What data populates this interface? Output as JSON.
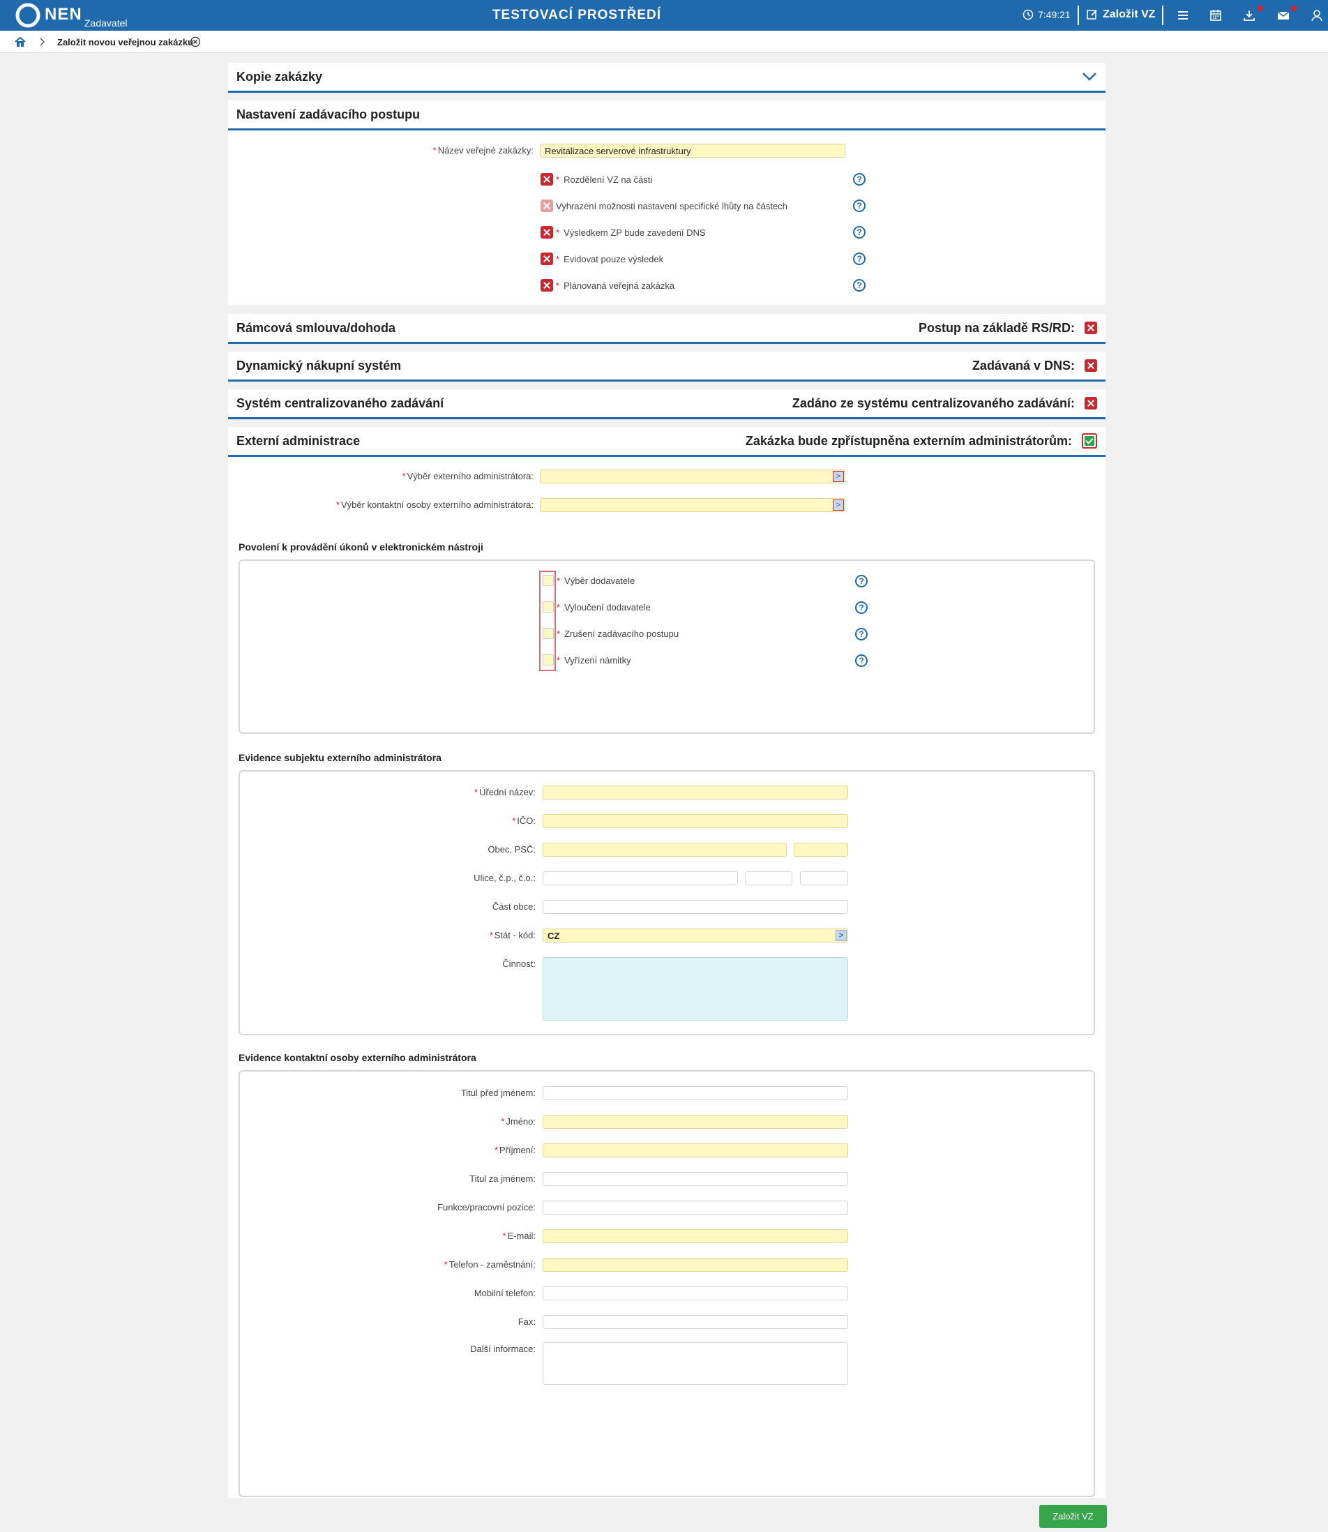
{
  "topbar": {
    "logo": "NEN",
    "logo_sub": "Zadavatel",
    "environment": "TESTOVACÍ PROSTŘEDÍ",
    "clock": "7:49:21",
    "new_button": "Založit VZ",
    "icons": [
      "clock-icon",
      "edit-icon",
      "menu-icon",
      "calendar-icon",
      "download-icon",
      "mail-icon",
      "user-icon"
    ],
    "accent": "#1e6aad"
  },
  "breadcrumb": {
    "current": "Založit novou veřejnou zakázku"
  },
  "kopie": {
    "title": "Kopie zakázky"
  },
  "nastaveni": {
    "title": "Nastavení zadávacího postupu",
    "nazev_label": "Název veřejné zakázky:",
    "nazev_value": "Revitalizace serverové infrastruktury",
    "options": [
      {
        "label": "Rozdělení VZ na části",
        "required": true
      },
      {
        "label": "Vyhrazení možnosti nastavení specifické lhůty na částech",
        "required": false
      },
      {
        "label": "Výsledkem ZP bude zavedení DNS",
        "required": true
      },
      {
        "label": "Evidovat pouze výsledek",
        "required": true
      },
      {
        "label": "Plánovaná veřejná zakázka",
        "required": true
      }
    ]
  },
  "ramcova": {
    "title": "Rámcová smlouva/dohoda",
    "right": "Postup na základě RS/RD:"
  },
  "dns": {
    "title": "Dynamický nákupní systém",
    "right": "Zadávaná v DNS:"
  },
  "centralni": {
    "title": "Systém centralizovaného zadávání",
    "right": "Zadáno ze systému centralizovaného zadávání:"
  },
  "externi": {
    "title": "Externí administrace",
    "right": "Zakázka bude zpřístupněna externím administrátorům:",
    "vyber_admin": "Výběr externího administrátora:",
    "vyber_osoba": "Výběr kontaktní osoby externího administrátora:"
  },
  "povoleni": {
    "title": "Povolení k provádění úkonů v elektronickém nástroji",
    "items": [
      "Výběr dodavatele",
      "Vyloučení dodavatele",
      "Zrušení zadávacího postupu",
      "Vyřízení námitky"
    ]
  },
  "subjekt": {
    "title": "Evidence subjektu externího administrátora",
    "uredni_nazev": "Úřední název:",
    "ico": "IČO:",
    "obec": "Obec, PSČ:",
    "ulice": "Ulice, č.p., č.o.:",
    "cast_obce": "Část obce:",
    "stat": "Stát - kód:",
    "stat_value": "CZ",
    "cinnost": "Činnost:"
  },
  "kontakt": {
    "title": "Evidence kontaktní osoby externího administrátora",
    "fields": [
      {
        "label": "Titul před jménem:",
        "required": false,
        "yellow": false
      },
      {
        "label": "Jméno:",
        "required": true,
        "yellow": true
      },
      {
        "label": "Příjmení:",
        "required": true,
        "yellow": true
      },
      {
        "label": "Titul za jménem:",
        "required": false,
        "yellow": false
      },
      {
        "label": "Funkce/pracovní pozice:",
        "required": false,
        "yellow": false
      },
      {
        "label": "E-mail:",
        "required": true,
        "yellow": true
      },
      {
        "label": "Telefon - zaměstnání:",
        "required": true,
        "yellow": true
      },
      {
        "label": "Mobilní telefon:",
        "required": false,
        "yellow": false
      },
      {
        "label": "Fax:",
        "required": false,
        "yellow": false
      }
    ],
    "dalsi": "Další informace:"
  },
  "submit": "Založit VZ"
}
